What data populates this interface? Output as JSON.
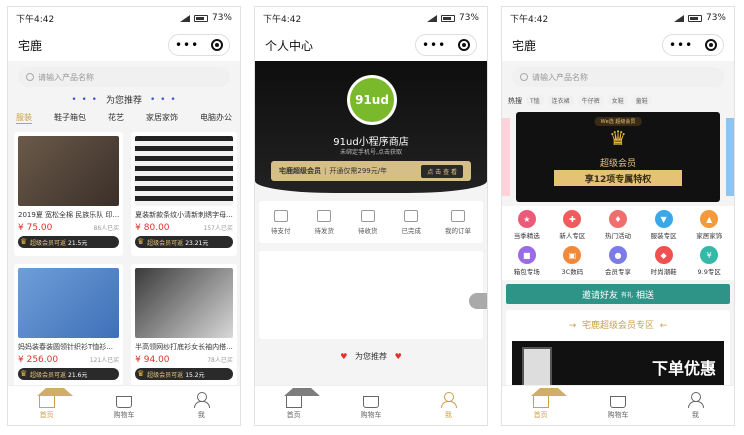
{
  "status": {
    "time": "下午4:42",
    "battery": "73%"
  },
  "colors": {
    "gold": "#c9a04c",
    "red": "#e0312b",
    "dark": "#2a2a2a",
    "teal": "#2e9488"
  },
  "phone1": {
    "title": "宅鹿",
    "search_placeholder": "请输入产品名称",
    "rec_title": "为您推荐",
    "cats": [
      "服装",
      "鞋子箱包",
      "花艺",
      "家居家饰",
      "电脑办公"
    ],
    "cards": [
      {
        "name": "2019夏 宽松全棉 民族乐队 印...",
        "price": "¥ 75.00",
        "sales": "86人已买",
        "vip": "超级会员可返",
        "vip_val": "21.5元"
      },
      {
        "name": "夏装新款条纹小清新刺绣字母...",
        "price": "¥ 80.00",
        "sales": "157人已买",
        "vip": "超级会员可返",
        "vip_val": "23.21元"
      },
      {
        "name": "妈妈装春装圆领针织衫T恤衫...",
        "price": "¥ 256.00",
        "sales": "121人已买",
        "vip": "超级会员可返",
        "vip_val": "21.6元"
      },
      {
        "name": "半高领网纱打底衫女长袖内搭...",
        "price": "¥ 94.00",
        "sales": "78人已买",
        "vip": "超级会员可返",
        "vip_val": "15.2元"
      }
    ]
  },
  "phone2": {
    "title": "个人中心",
    "logo_text": "91ud",
    "shop_name": "91ud小程序商店",
    "bind_hint": "未绑定手机号,点击获取",
    "vip_label": "宅鹿超级会员",
    "vip_desc": "开通仅需299元/年",
    "vip_btn": "点 击 查 看",
    "orders": [
      "待支付",
      "待发货",
      "待收货",
      "已完成",
      "我的订单"
    ],
    "rec_title": "为您推荐"
  },
  "phone3": {
    "title": "宅鹿",
    "search_placeholder": "请输入产品名称",
    "hot_label": "热搜",
    "hot_words": [
      "T恤",
      "连衣裙",
      "牛仔裤",
      "女鞋",
      "童鞋"
    ],
    "banner_top": "Ｗe选 超级会员",
    "banner_title": "超级会员",
    "banner_ribbon": "享12项专属特权",
    "icons": [
      {
        "label": "当季精选",
        "color": "#ec5a7a"
      },
      {
        "label": "新人专区",
        "color": "#f25b5b"
      },
      {
        "label": "热门活动",
        "color": "#f06e6e"
      },
      {
        "label": "服装专区",
        "color": "#3aa8e8"
      },
      {
        "label": "家居家饰",
        "color": "#f59a3a"
      },
      {
        "label": "箱包专场",
        "color": "#9a6be8"
      },
      {
        "label": "3C数码",
        "color": "#f08a3a"
      },
      {
        "label": "会员专享",
        "color": "#7c7ce8"
      },
      {
        "label": "时尚潮鞋",
        "color": "#f05050"
      },
      {
        "label": "9.9专区",
        "color": "#35b8a8"
      }
    ],
    "invite_a": "邀请好友",
    "invite_b": "有礼",
    "invite_c": "相送",
    "zone_title": "宅鹿超级会员专区",
    "zone_img_text": "下单优惠"
  },
  "tabs": [
    "首页",
    "购物车",
    "我"
  ]
}
